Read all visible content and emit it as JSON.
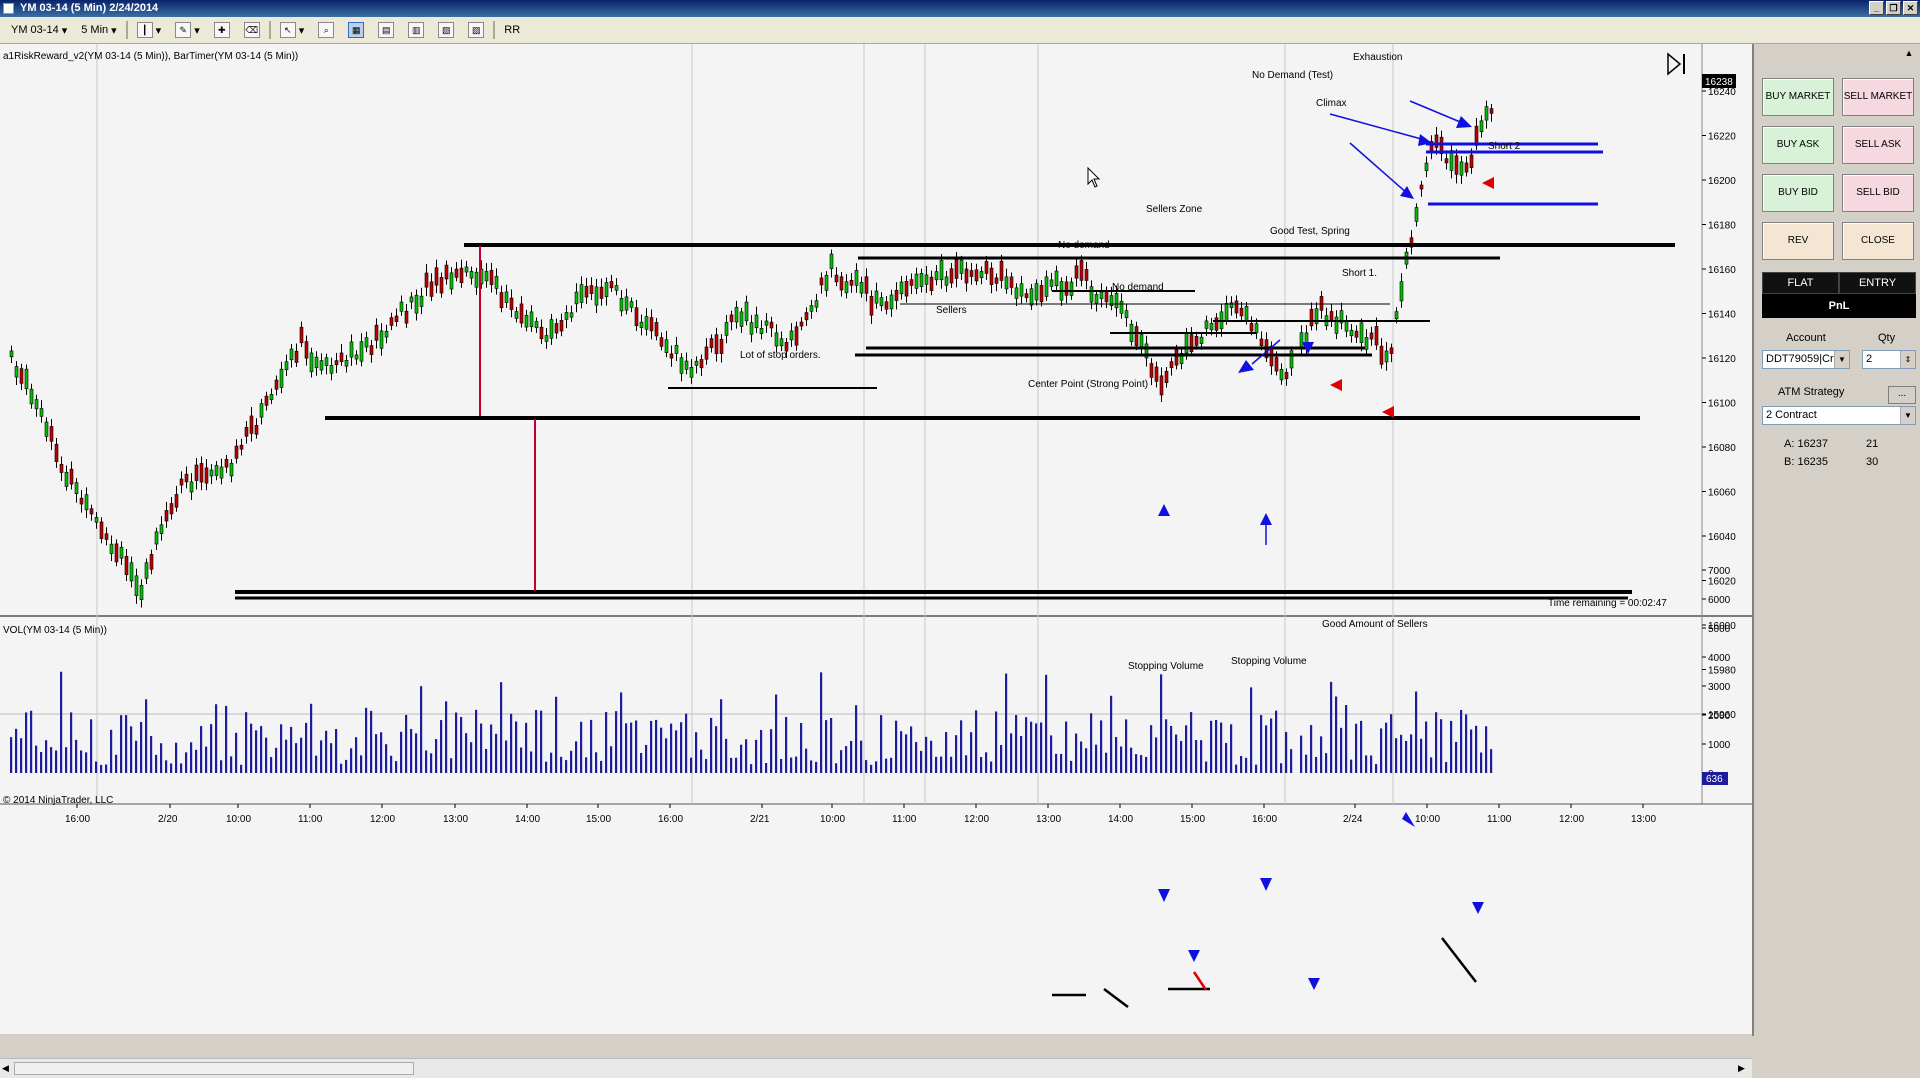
{
  "window": {
    "title": "YM 03-14 (5 Min)  2/24/2014"
  },
  "toolbar": {
    "instrument": "YM 03-14",
    "interval": "5 Min",
    "rr_label": "RR"
  },
  "price_panel": {
    "indicator_label": "a1RiskReward_v2(YM 03-14 (5 Min)), BarTimer(YM 03-14 (5 Min))",
    "y_ticks": [
      "16240",
      "16220",
      "16200",
      "16180",
      "16160",
      "16140",
      "16120",
      "16100",
      "16080",
      "16060",
      "16040",
      "16020",
      "16000",
      "15980",
      "15960"
    ],
    "current_price": "16238",
    "time_remaining": "Time remaining = 00:02:47"
  },
  "volume_panel": {
    "label": "VOL(YM 03-14 (5 Min))",
    "y_ticks": [
      "7000",
      "6000",
      "5000",
      "4000",
      "3000",
      "2000",
      "1000",
      "0"
    ],
    "current_volume": "636",
    "copyright": "© 2014 NinjaTrader, LLC"
  },
  "x_axis": {
    "ticks": [
      "16:00",
      "2/20",
      "10:00",
      "11:00",
      "12:00",
      "13:00",
      "14:00",
      "15:00",
      "16:00",
      "2/21",
      "10:00",
      "11:00",
      "12:00",
      "13:00",
      "14:00",
      "15:00",
      "16:00",
      "2/24",
      "10:00",
      "11:00",
      "12:00",
      "13:00"
    ]
  },
  "annotations": {
    "exhaustion": "Exhaustion",
    "no_demand_test": "No Demand (Test)",
    "climax": "Climax",
    "short2": "Short 2",
    "sellers_zone": "Sellers Zone",
    "no_demand1": "No demand",
    "good_test": "Good Test, Spring",
    "short1": "Short 1.",
    "no_demand2": "No demand",
    "sellers": "Sellers",
    "stop_orders": "Lot of stop orders.",
    "center_point": "Center Point (Strong Point)",
    "good_sellers": "Good Amount of Sellers",
    "stopping1": "Stopping Volume",
    "stopping2": "Stopping Volume"
  },
  "order_panel": {
    "buy_market": "BUY MARKET",
    "sell_market": "SELL MARKET",
    "buy_ask": "BUY ASK",
    "sell_ask": "SELL ASK",
    "buy_bid": "BUY BID",
    "sell_bid": "SELL BID",
    "rev": "REV",
    "close": "CLOSE",
    "flat": "FLAT",
    "entry": "ENTRY",
    "pnl": "PnL",
    "account_label": "Account",
    "qty_label": "Qty",
    "account_value": "DDT79059|Cr",
    "qty_value": "2",
    "atm_label": "ATM Strategy",
    "atm_value": "2 Contract",
    "ask_label": "A: 16237",
    "ask_size": "21",
    "bid_label": "B: 16235",
    "bid_size": "30",
    "dots": "..."
  },
  "colors": {
    "up": "#00c000",
    "down": "#c00000",
    "volume": "#1c1c9c",
    "level_blue": "#1010e0",
    "red_vline": "#c00030"
  }
}
